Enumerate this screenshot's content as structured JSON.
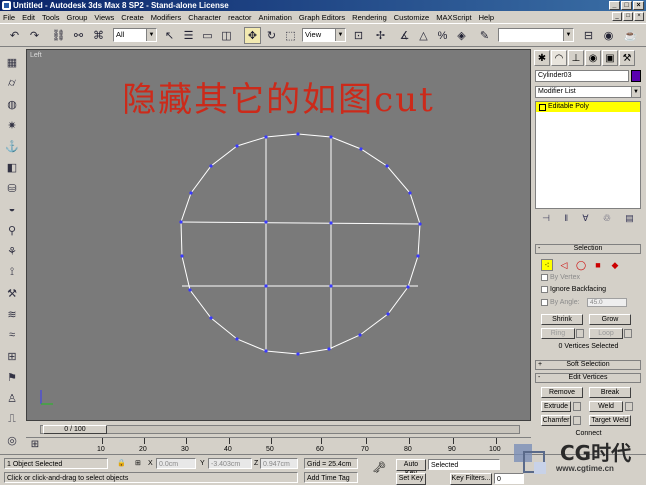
{
  "window": {
    "title": "Untitled - Autodesk 3ds Max 8 SP2 - Stand-alone License",
    "controls": [
      "_",
      "□",
      "×"
    ]
  },
  "menu": [
    "File",
    "Edit",
    "Tools",
    "Group",
    "Views",
    "Create",
    "Modifiers",
    "Character",
    "reactor",
    "Animation",
    "Graph Editors",
    "Rendering",
    "Customize",
    "MAXScript",
    "Help"
  ],
  "toolbar": {
    "selection_filter": "All",
    "reference_coord": "View"
  },
  "viewport": {
    "label": "Left",
    "overlay_text": "隐藏其它的如图cut",
    "overlay_color": "#cc2a1a",
    "background": "#7a7a7a"
  },
  "command_panel": {
    "object_name": "Cylinder03",
    "object_color": "#5a00b0",
    "modifier_list_label": "Modifier List",
    "stack_item": "Editable Poly",
    "selection_rollout": {
      "title": "Selection",
      "by_vertex": "By Vertex",
      "ignore_backfacing": "Ignore Backfacing",
      "by_angle": "By Angle:",
      "angle_value": "45.0",
      "shrink": "Shrink",
      "grow": "Grow",
      "ring": "Ring",
      "loop": "Loop",
      "info": "0 Vertices Selected"
    },
    "soft_selection_title": "Soft Selection",
    "edit_vertices": {
      "title": "Edit Vertices",
      "remove": "Remove",
      "break": "Break",
      "extrude": "Extrude",
      "weld": "Weld",
      "chamfer": "Chamfer",
      "target_weld": "Target Weld",
      "connect": "Connect"
    },
    "rollout_toggle_open": "-",
    "rollout_toggle_closed": "+"
  },
  "timeline": {
    "frame_display": "0 / 100",
    "ticks": [
      "10",
      "20",
      "30",
      "40",
      "50",
      "60",
      "70",
      "80",
      "90",
      "100"
    ]
  },
  "status": {
    "selection_info": "1 Object Selected",
    "prompt": "Click or click-and-drag to select objects",
    "x_label": "X",
    "x_value": "0.0cm",
    "y_label": "Y",
    "y_value": "-3.403cm",
    "z_label": "Z",
    "z_value": "0.947cm",
    "grid": "Grid = 25.4cm",
    "add_time_tag": "Add Time Tag",
    "auto_key": "Auto Key",
    "auto_key_mode": "Selected",
    "set_key": "Set Key",
    "key_filters": "Key Filters...",
    "frame_field": "0"
  },
  "watermark": {
    "brand": "CG时代",
    "sub": "www.cgtime.cn"
  },
  "icons": [
    "app-icon",
    "undo-icon",
    "redo-icon",
    "link-icon",
    "unlink-icon",
    "bind-icon",
    "select-icon",
    "select-by-name-icon",
    "rect-region-icon",
    "crossing-icon",
    "move-icon",
    "rotate-icon",
    "scale-icon",
    "mirror-icon",
    "snap-icon",
    "material-editor-icon",
    "render-icon",
    "create-tab-icon",
    "modify-tab-icon",
    "hierarchy-tab-icon",
    "motion-tab-icon",
    "display-tab-icon",
    "utilities-tab-icon",
    "vertex-icon",
    "edge-icon",
    "border-icon",
    "polygon-icon",
    "element-icon",
    "key-icon"
  ]
}
